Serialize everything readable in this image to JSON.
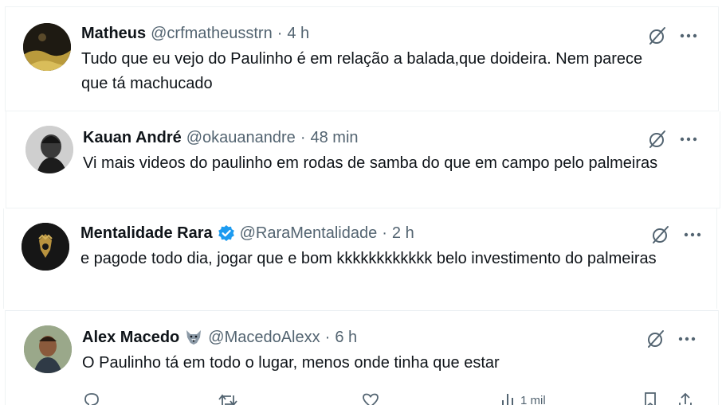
{
  "tweets": [
    {
      "name": "Matheus",
      "handle": "@crfmatheusstrn",
      "separator": "·",
      "time": "4 h",
      "text": "Tudo que eu vejo do Paulinho é em relação a balada,que doideira. Nem parece que tá machucado"
    },
    {
      "name": "Kauan André",
      "handle": "@okauanandre",
      "separator": "·",
      "time": "48 min",
      "text": "Vi mais videos do paulinho em rodas de samba do que em campo pelo palmeiras"
    },
    {
      "name": "Mentalidade Rara",
      "handle": "@RaraMentalidade",
      "separator": "·",
      "time": "2 h",
      "verified": true,
      "text": "e pagode todo dia, jogar que e bom kkkkkkkkkkkk belo investimento do palmeiras"
    },
    {
      "name": "Alex Macedo",
      "handle": "@MacedoAlexx",
      "separator": "·",
      "time": "6 h",
      "name_emoji": "wolf-icon",
      "text": "O Paulinho tá em todo o lugar, menos onde tinha que estar",
      "views": "1 mil"
    }
  ],
  "colors": {
    "text": "#0f1419",
    "secondary": "#536471",
    "verified": "#1d9bf0",
    "border": "#eff3f4"
  }
}
